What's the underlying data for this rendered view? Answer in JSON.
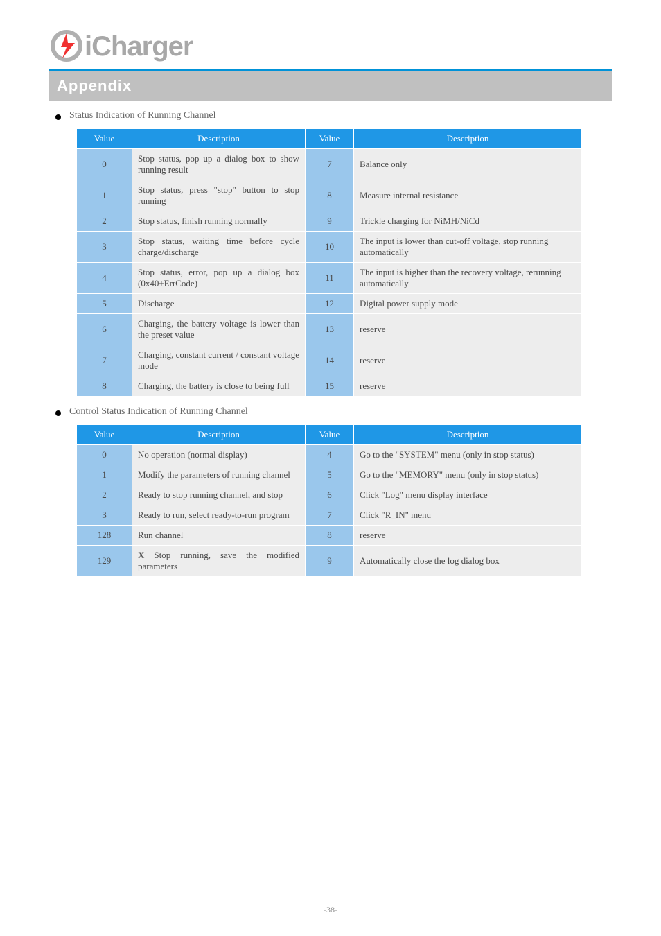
{
  "logo": {
    "i_text": "iCharger"
  },
  "header_title": "Appendix",
  "section1": {
    "title": "Status Indication of Running Channel",
    "head": [
      "Value",
      "Description",
      "Value",
      "Description"
    ],
    "rows": [
      {
        "v1": "0",
        "d1": "Stop status, pop up a dialog box to show running result",
        "v2": "7",
        "d2": "Balance only"
      },
      {
        "v1": "1",
        "d1": "Stop status, press \"stop\" button to stop running",
        "v2": "8",
        "d2": "Measure internal resistance"
      },
      {
        "v1": "2",
        "d1": "Stop status, finish running normally",
        "v2": "9",
        "d2": "Trickle charging for NiMH/NiCd"
      },
      {
        "v1": "3",
        "d1": "Stop status, waiting time before cycle charge/discharge",
        "v2": "10",
        "d2": "The input is lower than cut-off voltage, stop running automatically"
      },
      {
        "v1": "4",
        "d1": "Stop status, error, pop up a dialog box (0x40+ErrCode)",
        "v2": "11",
        "d2": "The input is higher than the recovery voltage, rerunning automatically"
      },
      {
        "v1": "5",
        "d1": "Discharge",
        "v2": "12",
        "d2": "Digital power supply mode"
      },
      {
        "v1": "6",
        "d1": "Charging, the battery voltage is lower than the preset value",
        "v2": "13",
        "d2": "reserve"
      },
      {
        "v1": "7",
        "d1": "Charging, constant current / constant voltage mode",
        "v2": "14",
        "d2": "reserve"
      },
      {
        "v1": "8",
        "d1": "Charging, the battery is close to being full",
        "v2": "15",
        "d2": "reserve"
      }
    ]
  },
  "section2": {
    "title": "Control Status Indication of Running Channel",
    "head": [
      "Value",
      "Description",
      "Value",
      "Description"
    ],
    "rows": [
      {
        "v1": "0",
        "d1": "No operation (normal display)",
        "v2": "4",
        "d2": "Go to the \"SYSTEM\" menu (only in stop status)"
      },
      {
        "v1": "1",
        "d1": "Modify the parameters of running channel",
        "v2": "5",
        "d2": "Go to the \"MEMORY\" menu (only in stop status)"
      },
      {
        "v1": "2",
        "d1": "Ready to stop running channel, and stop",
        "v2": "6",
        "d2": "Click \"Log\" menu display interface"
      },
      {
        "v1": "3",
        "d1": "Ready to run, select ready-to-run program",
        "v2": "7",
        "d2": "Click \"R_IN\" menu"
      },
      {
        "v1": "128",
        "d1": "Run channel",
        "v2": "8",
        "d2": "reserve"
      },
      {
        "v1": "129",
        "d1": "X Stop running, save the modified parameters",
        "v2": "9",
        "d2": "Automatically close the log dialog box"
      }
    ]
  },
  "footer": "-38-"
}
